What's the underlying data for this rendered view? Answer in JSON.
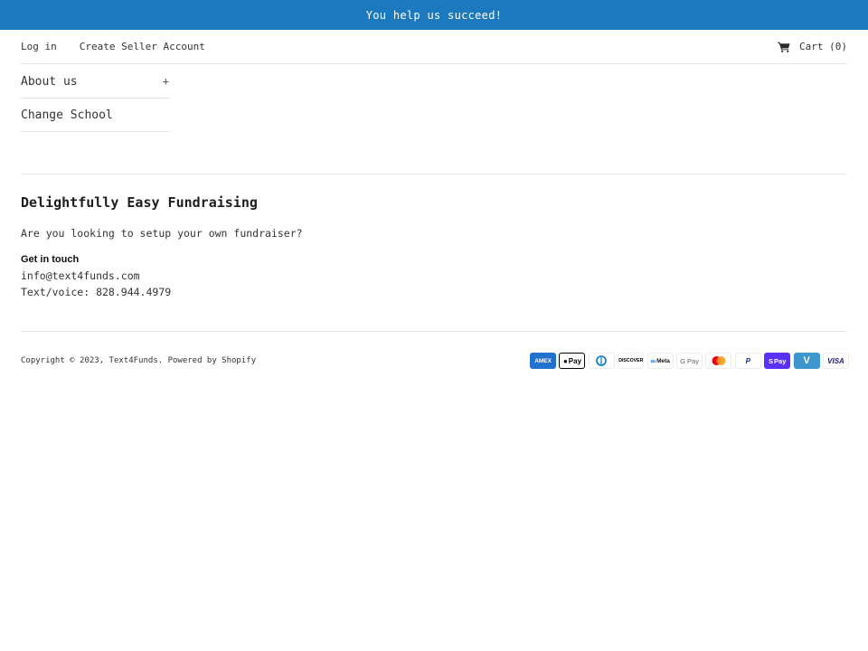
{
  "announcement": {
    "text": "You help us succeed!",
    "background": "#1c79bd"
  },
  "header": {
    "login_label": "Log in",
    "create_seller_label": "Create Seller Account",
    "cart_label": "Cart (0)",
    "cart_icon": "cart-icon"
  },
  "sidebar": {
    "items": [
      {
        "label": "About us",
        "expand_symbol": "+"
      },
      {
        "label": "Change School"
      }
    ]
  },
  "footer": {
    "title": "Delightfully Easy Fundraising",
    "question": "Are you looking to setup your own fundraiser?",
    "contact_heading": "Get in touch",
    "email": "info@text4funds.com",
    "phone": "Text/voice: 828.944.4979",
    "copyright_prefix": "Copyright © 2023,",
    "store_name": "Text4Funds",
    "powered_by": "Powered by Shopify",
    "payment_methods": [
      {
        "name": "American Express",
        "label": "AMEX"
      },
      {
        "name": "Apple Pay",
        "label": "Pay"
      },
      {
        "name": "Diners Club",
        "label": ""
      },
      {
        "name": "Discover",
        "label": "DISCOVER"
      },
      {
        "name": "Meta Pay",
        "label": "Meta"
      },
      {
        "name": "Google Pay",
        "label": "G Pay"
      },
      {
        "name": "Mastercard",
        "label": ""
      },
      {
        "name": "PayPal",
        "label": "P"
      },
      {
        "name": "Shop Pay",
        "label": "Pay"
      },
      {
        "name": "Venmo",
        "label": "V"
      },
      {
        "name": "Visa",
        "label": "VISA"
      }
    ]
  }
}
